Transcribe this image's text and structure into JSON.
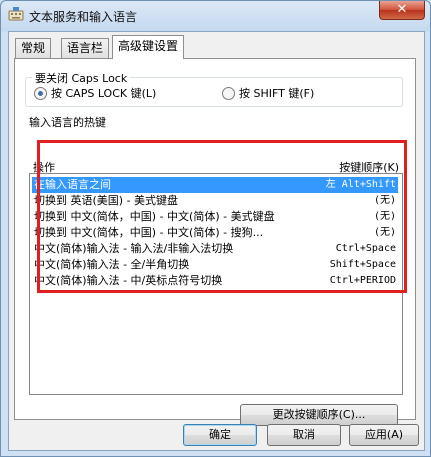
{
  "window": {
    "title": "文本服务和输入语言",
    "close_glyph": "✕"
  },
  "tabs": [
    "常规",
    "语言栏",
    "高级键设置"
  ],
  "caps_group": {
    "legend": "要关闭 Caps Lock",
    "option1": "按 CAPS LOCK 键(L)",
    "option2": "按 SHIFT 键(F)",
    "selected": "option1"
  },
  "hotkeys": {
    "legend": "输入语言的热键",
    "col_action": "操作",
    "col_keys": "按键顺序(K)",
    "rows": [
      {
        "action": "在输入语言之间",
        "keys": "左 Alt+Shift",
        "selected": true
      },
      {
        "action": "切换到 英语(美国) - 美式键盘",
        "keys": "(无)"
      },
      {
        "action": "切换到 中文(简体，中国) - 中文(简体) - 美式键盘",
        "keys": "(无)"
      },
      {
        "action": "切换到 中文(简体，中国) - 中文(简体) - 搜狗...",
        "keys": "(无)"
      },
      {
        "action": "中文(简体)输入法 - 输入法/非输入法切换",
        "keys": "Ctrl+Space"
      },
      {
        "action": "中文(简体)输入法 - 全/半角切换",
        "keys": "Shift+Space"
      },
      {
        "action": "中文(简体)输入法 - 中/英标点符号切换",
        "keys": "Ctrl+PERIOD"
      }
    ],
    "change_button": "更改按键顺序(C)..."
  },
  "footer": {
    "ok": "确定",
    "cancel": "取消",
    "apply": "应用(A)"
  }
}
